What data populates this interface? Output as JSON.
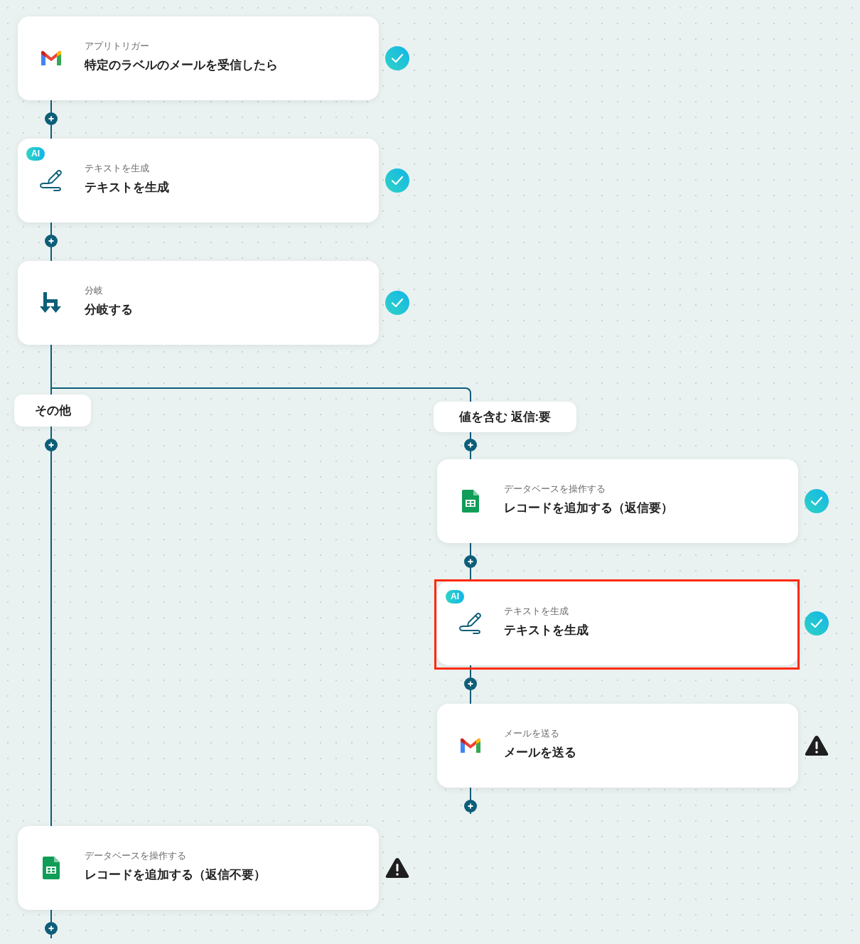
{
  "flow": {
    "steps": [
      {
        "kind": "gmail",
        "category": "アプリトリガー",
        "title": "特定のラベルのメールを受信したら",
        "warning": false,
        "highlighted": false
      },
      {
        "kind": "ai",
        "badge": "AI",
        "category": "テキストを生成",
        "title": "テキストを生成",
        "warning": false,
        "highlighted": false
      },
      {
        "kind": "branch",
        "category": "分岐",
        "title": "分岐する",
        "warning": false,
        "highlighted": false
      }
    ],
    "branches": [
      {
        "label": "その他",
        "steps": [
          {
            "kind": "sheets",
            "category": "データベースを操作する",
            "title": "レコードを追加する（返信不要）",
            "warning": true,
            "highlighted": false
          }
        ]
      },
      {
        "label": "値を含む 返信:要",
        "steps": [
          {
            "kind": "sheets",
            "category": "データベースを操作する",
            "title": "レコードを追加する（返信要）",
            "warning": false,
            "highlighted": false
          },
          {
            "kind": "ai",
            "badge": "AI",
            "category": "テキストを生成",
            "title": "テキストを生成",
            "warning": false,
            "highlighted": true
          },
          {
            "kind": "gmail",
            "category": "メールを送る",
            "title": "メールを送る",
            "warning": true,
            "highlighted": false
          }
        ]
      }
    ]
  }
}
